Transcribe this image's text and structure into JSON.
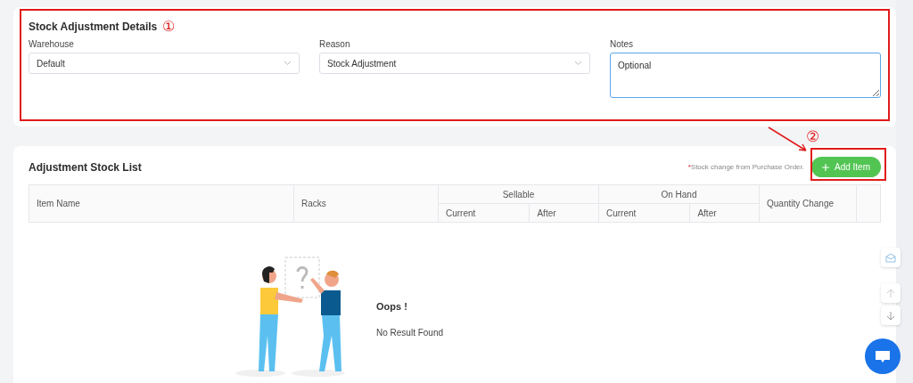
{
  "details": {
    "title": "Stock Adjustment Details",
    "marker": "①",
    "fields": [
      {
        "kind": "select",
        "label": "Warehouse",
        "value": "Default"
      },
      {
        "kind": "select",
        "label": "Reason",
        "value": "Stock Adjustment"
      },
      {
        "kind": "textarea",
        "label": "Notes",
        "placeholder": "Optional",
        "focused": true
      }
    ]
  },
  "stock_list": {
    "title": "Adjustment Stock List",
    "note_mark": "*",
    "note": "Stock change from Purchase Order.",
    "button": "Add Item",
    "marker": "②",
    "table": {
      "columns": [
        {
          "label": "Item Name"
        },
        {
          "label": "Racks"
        },
        {
          "label": "Sellable",
          "children": [
            "Current",
            "After"
          ]
        },
        {
          "label": "On Hand",
          "children": [
            "Current",
            "After"
          ]
        },
        {
          "label": "Quantity Change"
        }
      ]
    },
    "empty": {
      "title": "Oops !",
      "message": "No Result Found"
    }
  }
}
